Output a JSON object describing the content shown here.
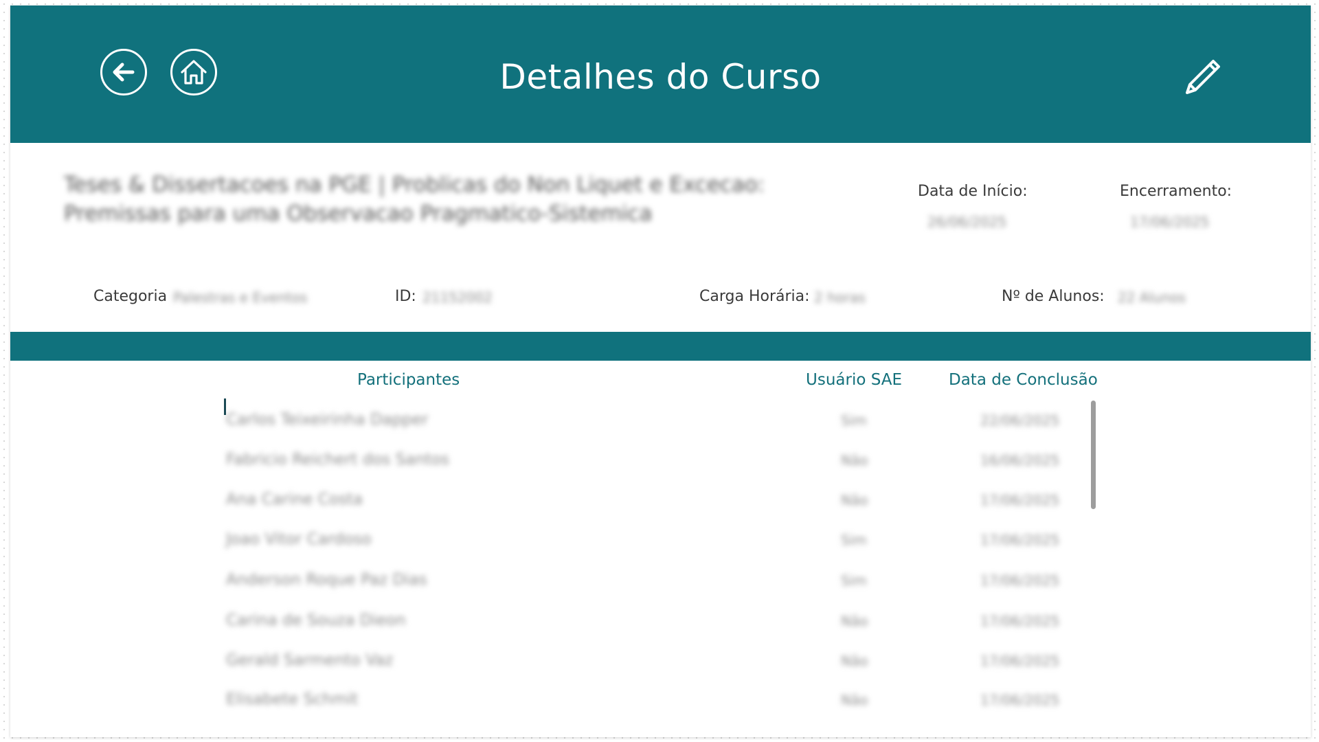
{
  "header": {
    "title": "Detalhes do Curso",
    "back_icon": "arrow-left-icon",
    "home_icon": "home-icon",
    "edit_icon": "pencil-icon",
    "background_color": "#10727d"
  },
  "course": {
    "name": "Teses & Dissertacoes na PGE | Problicas do Non Liquet e Excecao: Premissas para uma Observacao Pragmatico-Sistemica",
    "start_label": "Data de Início:",
    "start_value": "26/06/2025",
    "end_label": "Encerramento:",
    "end_value": "17/06/2025",
    "category_label": "Categoria",
    "category_value": "Palestras e Eventos",
    "id_label": "ID:",
    "id_value": "21152002",
    "hours_label": "Carga Horária:",
    "hours_value": "2 horas",
    "students_label": "Nº de Alunos:",
    "students_value": "22 Alunos"
  },
  "table": {
    "headers": {
      "participants": "Participantes",
      "sae_user": "Usuário SAE",
      "completion_date": "Data de Conclusão"
    },
    "rows": [
      {
        "name": "Carlos Teixeirinha Dapper",
        "sae": "Sim",
        "date": "22/06/2025"
      },
      {
        "name": "Fabricio Reichert dos Santos",
        "sae": "Não",
        "date": "16/06/2025"
      },
      {
        "name": "Ana Carine Costa",
        "sae": "Não",
        "date": "17/06/2025"
      },
      {
        "name": "Joao Vitor Cardoso",
        "sae": "Sim",
        "date": "17/06/2025"
      },
      {
        "name": "Anderson Roque Paz Dias",
        "sae": "Sim",
        "date": "17/06/2025"
      },
      {
        "name": "Carina de Souza Dieon",
        "sae": "Não",
        "date": "17/06/2025"
      },
      {
        "name": "Gerald Sarmento Vaz",
        "sae": "Não",
        "date": "17/06/2025"
      },
      {
        "name": "Elisabete Schmit",
        "sae": "Não",
        "date": "17/06/2025"
      }
    ]
  }
}
